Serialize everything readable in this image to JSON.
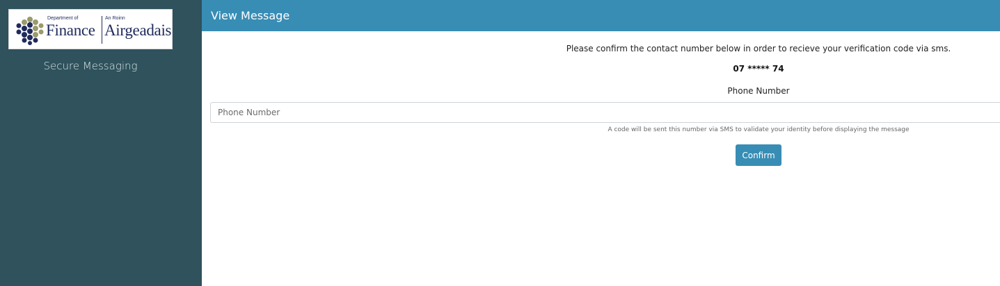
{
  "sidebar": {
    "logo": {
      "small_left": "Department of",
      "big_left": "Finance",
      "small_right": "An Roinn",
      "big_right": "Airgeadais"
    },
    "title": "Secure Messaging"
  },
  "header": {
    "title": "View Message"
  },
  "main": {
    "instruction": "Please confirm the contact number below in order to recieve your verification code via sms.",
    "masked_number": "07 ***** 74",
    "field_label": "Phone Number",
    "phone_placeholder": "Phone Number",
    "help_text": "A code will be sent this number via SMS to validate your identity before displaying the message",
    "confirm_label": "Confirm"
  },
  "colors": {
    "sidebar_bg": "#2f525c",
    "header_bg": "#388db5",
    "button_bg": "#388db5",
    "logo_navy": "#1f2a5c",
    "logo_olive": "#9a9a6a"
  }
}
